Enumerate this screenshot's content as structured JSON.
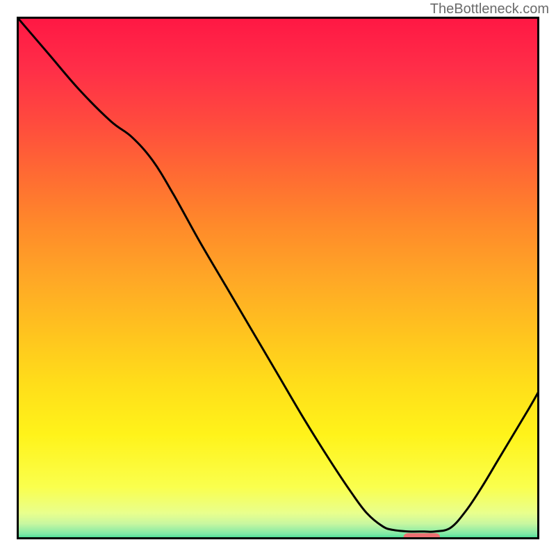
{
  "watermark": "TheBottleneck.com",
  "chart_data": {
    "type": "line",
    "title": "",
    "xlabel": "",
    "ylabel": "",
    "xlim": [
      0,
      100
    ],
    "ylim": [
      0,
      100
    ],
    "grid": false,
    "background_gradient": {
      "stops": [
        {
          "offset": 0.0,
          "color": "#ff1744"
        },
        {
          "offset": 0.1,
          "color": "#ff2e48"
        },
        {
          "offset": 0.2,
          "color": "#ff4a3e"
        },
        {
          "offset": 0.3,
          "color": "#ff6a33"
        },
        {
          "offset": 0.4,
          "color": "#ff8a2a"
        },
        {
          "offset": 0.5,
          "color": "#ffa726"
        },
        {
          "offset": 0.6,
          "color": "#ffc21f"
        },
        {
          "offset": 0.7,
          "color": "#ffdd1a"
        },
        {
          "offset": 0.8,
          "color": "#fff31a"
        },
        {
          "offset": 0.9,
          "color": "#faff4d"
        },
        {
          "offset": 0.95,
          "color": "#e9ff8d"
        },
        {
          "offset": 0.97,
          "color": "#c8f7a0"
        },
        {
          "offset": 0.99,
          "color": "#7fe8a6"
        },
        {
          "offset": 1.0,
          "color": "#33d98f"
        }
      ]
    },
    "curve": {
      "comment": "x,y in 0..100 (chart data coords); y=0 bottom, y=100 top",
      "points": [
        [
          0.0,
          100.0
        ],
        [
          6.0,
          93.0
        ],
        [
          12.0,
          86.0
        ],
        [
          18.0,
          80.0
        ],
        [
          22.0,
          77.0
        ],
        [
          26.0,
          72.5
        ],
        [
          30.0,
          66.0
        ],
        [
          35.0,
          57.0
        ],
        [
          40.0,
          48.5
        ],
        [
          45.0,
          40.0
        ],
        [
          50.0,
          31.5
        ],
        [
          55.0,
          23.0
        ],
        [
          60.0,
          15.0
        ],
        [
          64.0,
          9.0
        ],
        [
          67.0,
          5.0
        ],
        [
          70.0,
          2.5
        ],
        [
          72.0,
          1.8
        ],
        [
          75.0,
          1.5
        ],
        [
          78.0,
          1.5
        ],
        [
          80.0,
          1.5
        ],
        [
          83.0,
          2.2
        ],
        [
          86.0,
          5.5
        ],
        [
          89.0,
          10.0
        ],
        [
          92.0,
          15.0
        ],
        [
          95.0,
          20.0
        ],
        [
          98.0,
          25.0
        ],
        [
          100.0,
          28.5
        ]
      ]
    },
    "marker": {
      "comment": "pink rounded bar near bottom, approximate data coords",
      "x_start": 74.0,
      "x_end": 81.0,
      "y": 0.3,
      "color": "#ef6f72"
    },
    "border_color": "#000000"
  }
}
